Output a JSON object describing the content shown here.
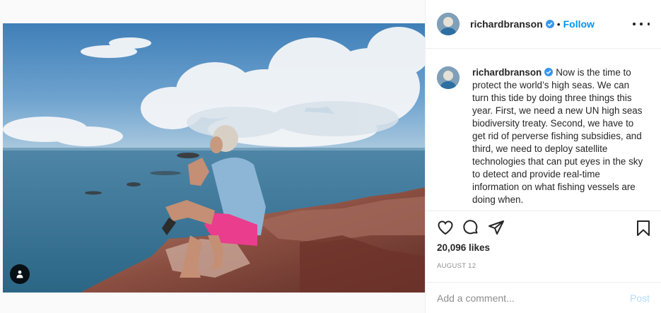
{
  "header": {
    "username": "richardbranson",
    "separator": "•",
    "follow_label": "Follow"
  },
  "caption": {
    "username": "richardbranson",
    "text": "Now is the time to protect the world’s high seas. We can turn this tide by doing three things this year. First, we need a new UN high seas biodiversity treaty. Second, we have to get rid of perverse fishing subsidies, and third, we need to deploy satellite technologies that can put eyes in the sky to detect and provide real-time information on what fishing vessels are doing when."
  },
  "stats": {
    "likes": "20,096 likes",
    "date": "AUGUST 12"
  },
  "comment": {
    "placeholder": "Add a comment...",
    "post_label": "Post"
  },
  "icons": {
    "verified": "verified-badge-icon",
    "more": "more-options-icon",
    "like": "heart-icon",
    "comment": "comment-icon",
    "share": "share-icon",
    "save": "bookmark-icon",
    "tags": "user-tag-icon"
  },
  "colors": {
    "accent": "#0095f6",
    "verified": "#3897f0",
    "post_disabled": "#b3dbff",
    "muted": "#8e8e8e",
    "text": "#262626"
  }
}
